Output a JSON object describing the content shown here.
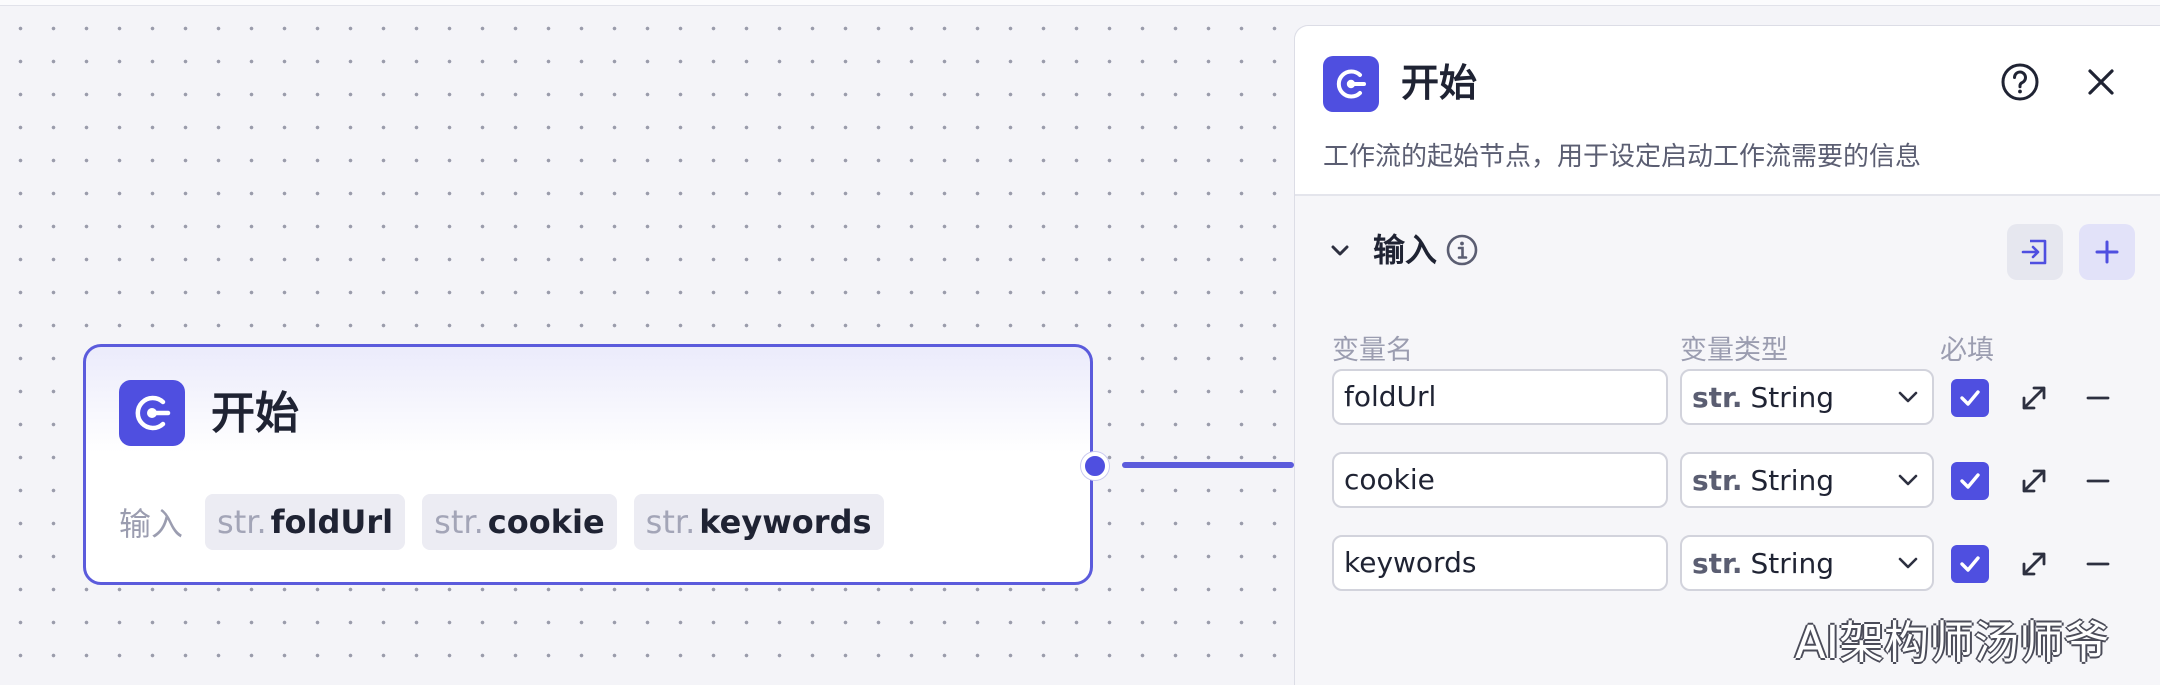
{
  "node": {
    "title": "开始",
    "inputs_label": "输入",
    "variables": [
      {
        "type": "str.",
        "name": "foldUrl"
      },
      {
        "type": "str.",
        "name": "cookie"
      },
      {
        "type": "str.",
        "name": "keywords"
      }
    ]
  },
  "panel": {
    "title": "开始",
    "description": "工作流的起始节点，用于设定启动工作流需要的信息",
    "section_title": "输入",
    "columns": {
      "name": "变量名",
      "type": "变量类型",
      "required": "必填"
    },
    "rows": [
      {
        "name": "foldUrl",
        "type_prefix": "str.",
        "type": "String",
        "required": true
      },
      {
        "name": "cookie",
        "type_prefix": "str.",
        "type": "String",
        "required": true
      },
      {
        "name": "keywords",
        "type_prefix": "str.",
        "type": "String",
        "required": true
      }
    ]
  },
  "watermark": "AI架构师汤师爷",
  "colors": {
    "accent": "#4f4fe0",
    "edge": "#5b5bdc"
  }
}
